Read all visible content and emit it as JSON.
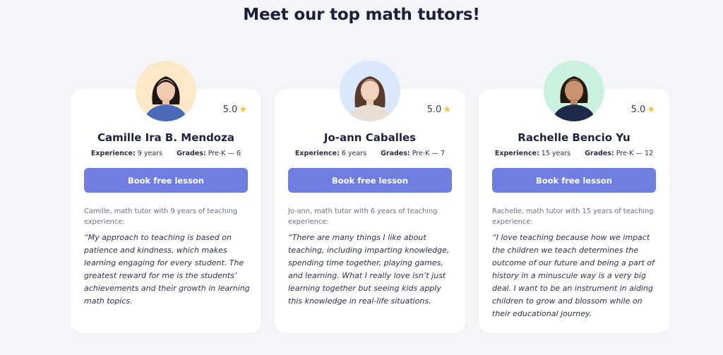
{
  "page": {
    "heading": "Meet our top math tutors!"
  },
  "colors": {
    "accent": "#6f7ee0",
    "star": "#f6c33a",
    "avatar_bg_1": "#fde9c8",
    "avatar_bg_2": "#d9e8fb",
    "avatar_bg_3": "#c9f1de"
  },
  "labels": {
    "experience": "Experience:",
    "grades": "Grades:",
    "star_icon": "star-icon"
  },
  "tutors": [
    {
      "name": "Camille Ira B. Mendoza",
      "rating": "5.0",
      "experience": "9 years",
      "grades": "Pre-K — 6",
      "button": "Book free lesson",
      "intro": "Camille, math tutor with 9 years of teaching experience:",
      "quote": "“My approach to teaching is based on patience and kindness, which makes learning engaging for every student. The greatest reward for me is the students’ achievements and their growth in learning math topics."
    },
    {
      "name": "Jo-ann Caballes",
      "rating": "5.0",
      "experience": "6 years",
      "grades": "Pre-K — 7",
      "button": "Book free lesson",
      "intro": "Jo-ann, math tutor with 6 years of teaching experience:",
      "quote": "“There are many things I like about teaching, including imparting knowledge, spending time together, playing games, and learning. What I really love isn’t just learning together but seeing kids apply this knowledge in real-life situations."
    },
    {
      "name": "Rachelle Bencio Yu",
      "rating": "5.0",
      "experience": "15 years",
      "grades": "Pre-K — 12",
      "button": "Book free lesson",
      "intro": "Rachelle, math tutor with 15 years of teaching experience:",
      "quote": "“I love teaching because how we impact the children we teach determines the outcome of our future and being a part of history in a minuscule way is a very big deal. I want to be an instrument in aiding children to grow and blossom while on their educational journey."
    }
  ]
}
